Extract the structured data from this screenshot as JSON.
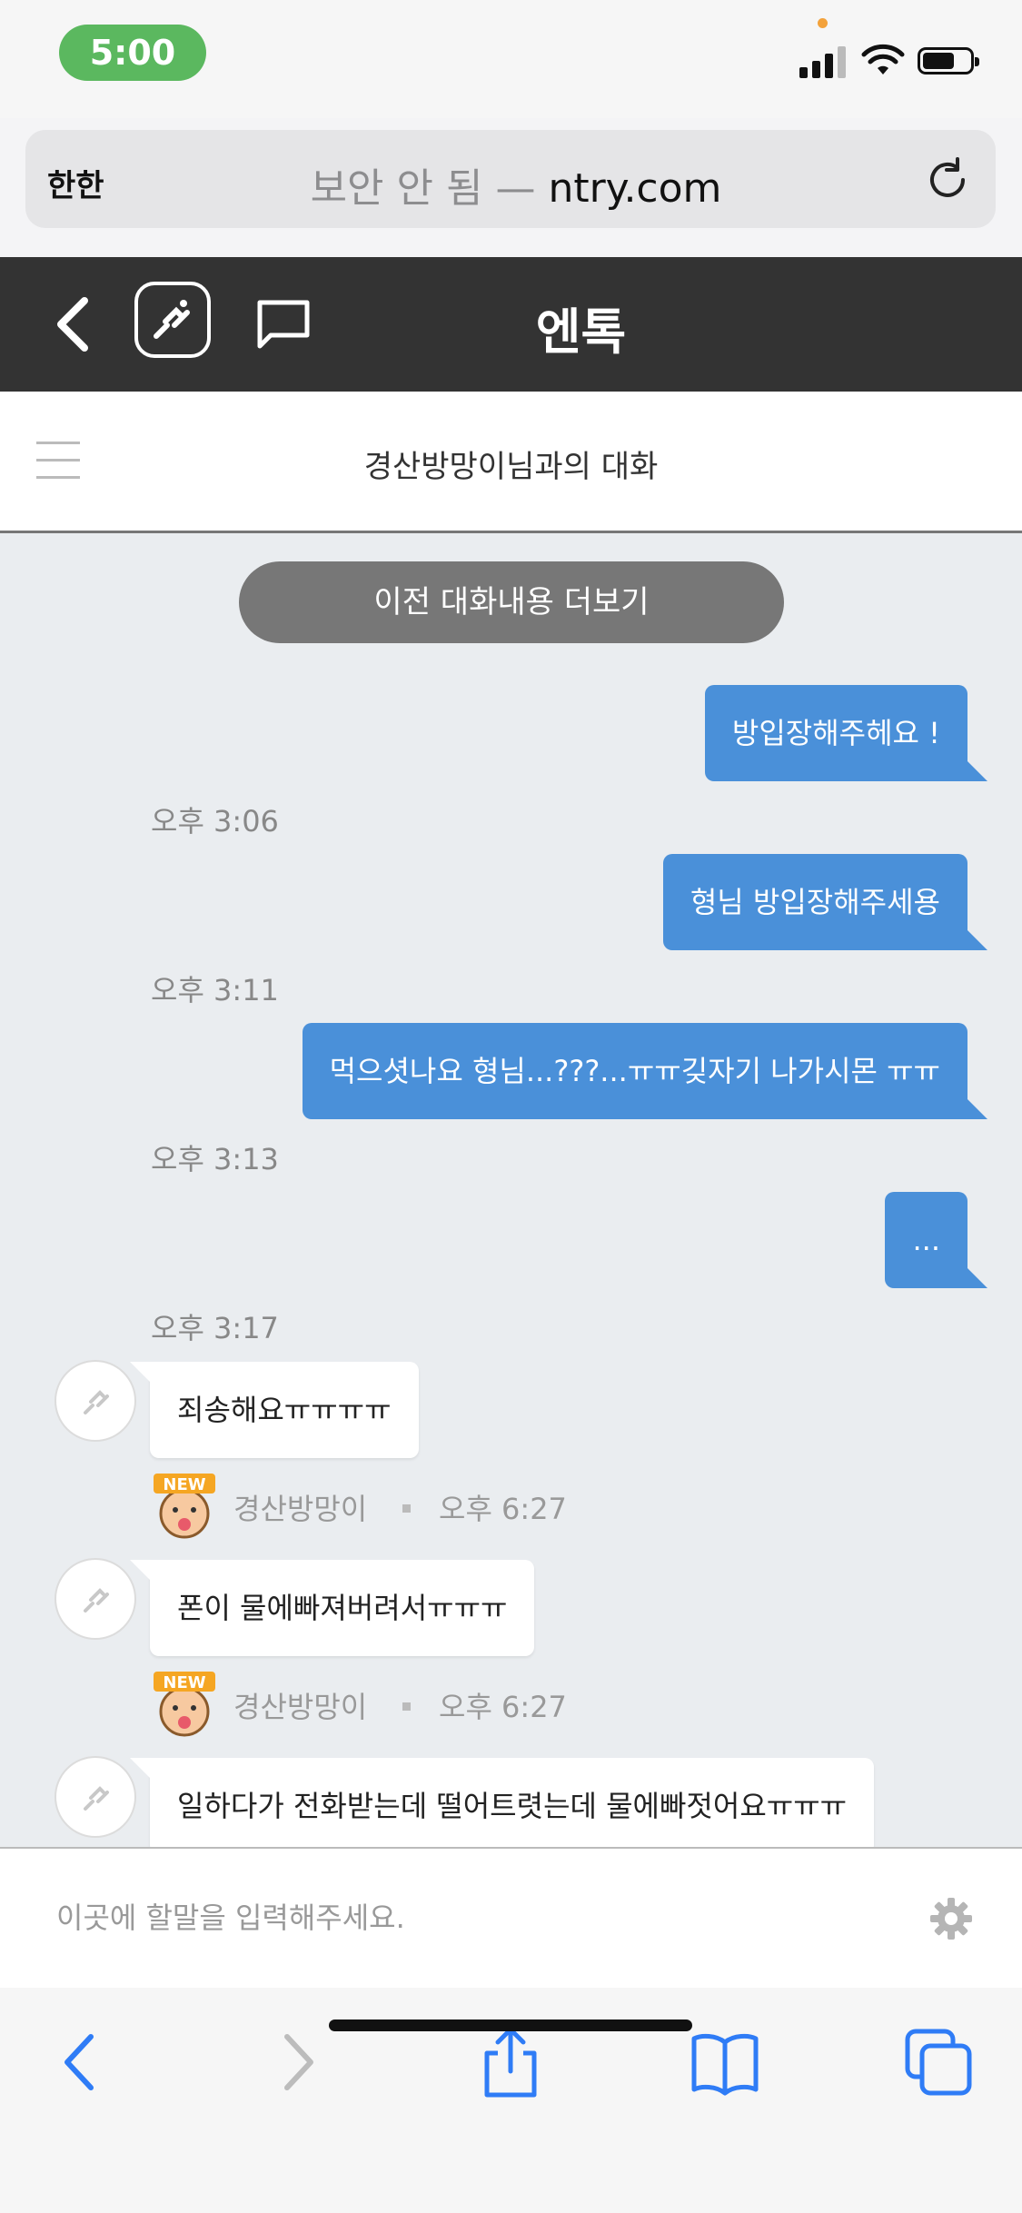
{
  "status_bar": {
    "time": "5:00"
  },
  "browser": {
    "text_size_label": "한한",
    "insecure_label": "보안 안 됨 — ",
    "host": "ntry.com"
  },
  "app": {
    "title": "엔톡"
  },
  "conversation": {
    "title": "경산방망이님과의 대화",
    "load_more": "이전 대화내용 더보기"
  },
  "outgoing": [
    {
      "text": "방입장해주헤요 !",
      "time": "오후 3:06"
    },
    {
      "text": "형님 방입장해주세용",
      "time": "오후 3:11"
    },
    {
      "text": "먹으셧나요 형님...???...ㅠㅠ깆자기 나가시몬 ㅠㅠ",
      "time": "오후 3:13"
    },
    {
      "text": "...",
      "time": "오후 3:17"
    }
  ],
  "incoming": [
    {
      "text": "죄송해요ㅠㅠㅠㅠ",
      "sender": "경산방망이",
      "time": "오후 6:27"
    },
    {
      "text": "폰이 물에빠져버려서ㅠㅠㅠ",
      "sender": "경산방망이",
      "time": "오후 6:27"
    },
    {
      "text": "일하다가 전화받는데 떨어트렷는데 물에빠젓어요ㅠㅠㅠ"
    }
  ],
  "input": {
    "placeholder": "이곳에 할말을 입력해주세요."
  },
  "colors": {
    "header_bg": "#333333",
    "outgoing_bubble": "#4a90d9",
    "time_pill": "#5bb85f",
    "toolbar_accent": "#2f7cf6"
  },
  "icons": {
    "back": "chevron-left-icon",
    "logo": "ntry-logo-icon",
    "chat": "chat-bubble-icon",
    "menu": "hamburger-menu-icon",
    "settings": "gear-icon",
    "reload": "reload-icon",
    "share": "share-icon",
    "bookmarks": "book-icon",
    "tabs": "tabs-icon"
  }
}
